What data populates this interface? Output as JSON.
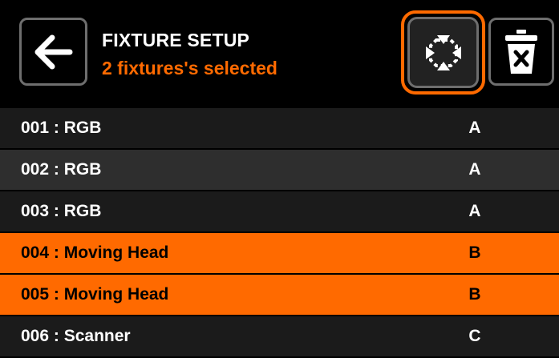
{
  "header": {
    "title": "FIXTURE SETUP",
    "subtitle": "2 fixtures's selected",
    "back_icon": "arrow-left-icon",
    "select_icon": "select-contract-icon",
    "delete_icon": "trash-x-icon"
  },
  "colors": {
    "accent": "#ff6a00",
    "row_dark": "#1b1b1b",
    "row_mid": "#2e2e2e",
    "border": "#6e6e6e"
  },
  "fixtures": [
    {
      "name": "001 : RGB",
      "group": "A",
      "selected": false
    },
    {
      "name": "002 : RGB",
      "group": "A",
      "selected": false
    },
    {
      "name": "003 : RGB",
      "group": "A",
      "selected": false
    },
    {
      "name": "004 : Moving Head",
      "group": "B",
      "selected": true
    },
    {
      "name": "005 : Moving Head",
      "group": "B",
      "selected": true
    },
    {
      "name": "006 : Scanner",
      "group": "C",
      "selected": false
    }
  ]
}
